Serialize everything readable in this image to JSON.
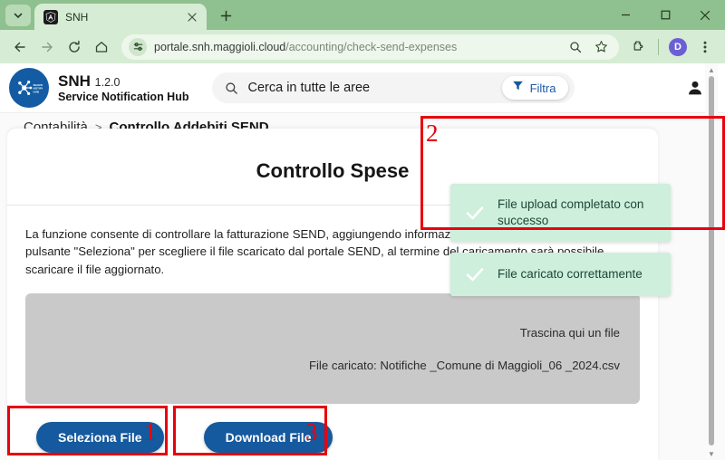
{
  "browser": {
    "tab": {
      "title": "SNH",
      "favicon_icon": "angular-shield-icon",
      "close_icon": "close-icon"
    },
    "tab_search_icon": "chevron-down-icon",
    "new_tab_icon": "plus-icon",
    "window_controls": {
      "minimize": "minimize-icon",
      "maximize": "maximize-icon",
      "close": "close-icon"
    },
    "nav": {
      "back_icon": "arrow-left-icon",
      "forward_icon": "arrow-right-icon",
      "reload_icon": "reload-icon",
      "home_icon": "home-icon"
    },
    "omnibox": {
      "site_info_icon": "tune-settings-icon",
      "url_host": "portale.snh.maggioli.cloud",
      "url_path": "/accounting/check-send-expenses",
      "zoom_icon": "zoom-search-icon",
      "bookmark_icon": "star-icon"
    },
    "extensions_icon": "puzzle-extension-icon",
    "profile_initial": "D",
    "menu_icon": "three-dot-menu-icon"
  },
  "app": {
    "brand": {
      "logo_icon": "network-hub-logo-icon",
      "name": "SNH",
      "version": "1.2.0",
      "subtitle": "Service Notification Hub"
    },
    "search": {
      "icon": "search-icon",
      "placeholder": "Cerca in tutte le aree",
      "value": "",
      "filter_icon": "filter-funnel-icon",
      "filter_label": "Filtra"
    },
    "account_icon": "user-avatar-icon"
  },
  "breadcrumb": {
    "parent": "Contabilità",
    "separator": ">",
    "current": "Controllo Addebiti SEND"
  },
  "main": {
    "title": "Controllo Spese",
    "description": "La funzione consente di controllare la fatturazione SEND, aggiungendo informazioni specifiche di SNH. Utilizzare il pulsante \"Seleziona\" per scegliere il file scaricato dal portale SEND, al termine del caricamento sarà possibile scaricare il file aggiornato.",
    "dropzone": {
      "hint": "Trascina qui un file",
      "uploaded": "File caricato: Notifiche _Comune di Maggioli_06 _2024.csv"
    },
    "buttons": {
      "select_file": "Seleziona File",
      "download_file": "Download File"
    }
  },
  "toasts": [
    {
      "icon": "check-icon",
      "message": "File upload completato con successo"
    },
    {
      "icon": "check-icon",
      "message": "File caricato correttamente"
    }
  ],
  "annotations": [
    {
      "number": "1"
    },
    {
      "number": "2"
    },
    {
      "number": "3"
    }
  ],
  "colors": {
    "browser_chrome": "#8fc08f",
    "toolbar": "#d7ecd4",
    "brand_blue": "#135ca3",
    "button_blue": "#15599e",
    "toast_green": "#cdefdc",
    "toast_text": "#1f4636",
    "annotation_red": "#e8000d",
    "dropzone_gray": "#c9c9c9"
  }
}
